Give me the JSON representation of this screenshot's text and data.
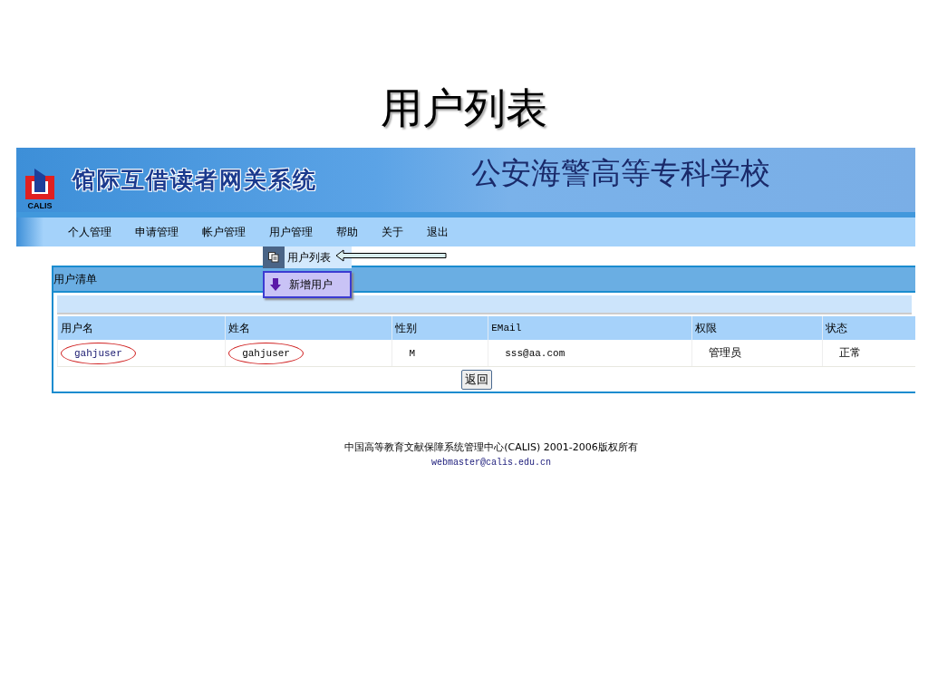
{
  "slide_title": "用户列表",
  "banner": {
    "logo_text": "CALIS",
    "system_name": "馆际互借读者网关系统",
    "school_name": "公安海警高等专科学校"
  },
  "nav": {
    "items": [
      "个人管理",
      "申请管理",
      "帐户管理",
      "用户管理",
      "帮助",
      "关于",
      "退出"
    ]
  },
  "menu": {
    "items": [
      {
        "label": "用户列表",
        "kind": "list",
        "selected": false
      },
      {
        "label": "新增用户",
        "kind": "add",
        "selected": true
      }
    ]
  },
  "panel": {
    "title": "用户清单",
    "table": {
      "columns": [
        "用户名",
        "姓名",
        "性别",
        "EMail",
        "权限",
        "状态"
      ],
      "rows": [
        {
          "cells": [
            {
              "text": "gahjuser",
              "circled": true
            },
            {
              "text": "gahjuser",
              "circled": true
            },
            {
              "text": "M",
              "circled": false
            },
            {
              "text": "sss@aa.com",
              "circled": false
            },
            {
              "text": "管理员",
              "circled": false
            },
            {
              "text": "正常",
              "circled": false
            }
          ]
        }
      ]
    },
    "back_button": "返回"
  },
  "footer": {
    "copyright": "中国高等教育文献保障系统管理中心(CALIS) 2001-2006版权所有",
    "email": "webmaster@calis.edu.cn"
  }
}
